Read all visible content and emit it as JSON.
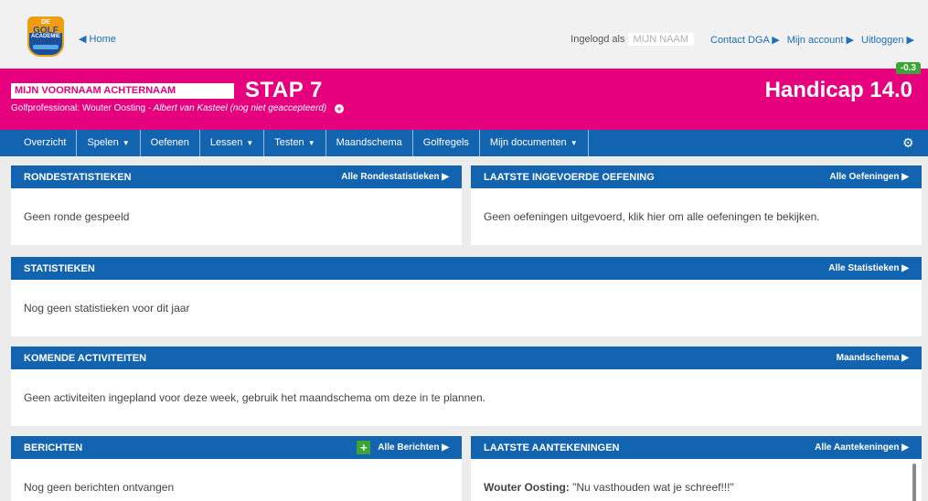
{
  "logo": {
    "line1": "DE",
    "line2": "GOLF",
    "line3": "ACADEMIE"
  },
  "header": {
    "home": "◀ Home",
    "logged_in_as": "Ingelogd als",
    "user_name": "MIJN NAAM",
    "links": [
      "Contact DGA ▶",
      "Mijn account ▶",
      "Uitloggen ▶"
    ]
  },
  "hero": {
    "full_name": "MIJN VOORNAAM ACHTERNAAM",
    "step": "STAP 7",
    "pro_label": "Golfprofessional:",
    "pro_name": "Wouter Oosting",
    "pending": "- Albert van Kasteel (nog niet geaccepteerd)",
    "handicap": "Handicap 14.0",
    "delta": "-0.3"
  },
  "nav": {
    "items": [
      {
        "label": "Overzicht",
        "caret": ""
      },
      {
        "label": "Spelen",
        "caret": "▼"
      },
      {
        "label": "Oefenen",
        "caret": ""
      },
      {
        "label": "Lessen",
        "caret": "▼"
      },
      {
        "label": "Testen",
        "caret": "▼"
      },
      {
        "label": "Maandschema",
        "caret": ""
      },
      {
        "label": "Golfregels",
        "caret": ""
      },
      {
        "label": "Mijn documenten",
        "caret": "▼"
      }
    ]
  },
  "panels": {
    "rondes": {
      "title": "RONDESTATISTIEKEN",
      "link": "Alle Rondestatistieken ▶",
      "body": "Geen ronde gespeeld"
    },
    "oefening": {
      "title": "LAATSTE INGEVOERDE OEFENING",
      "link": "Alle Oefeningen ▶",
      "body": "Geen oefeningen uitgevoerd, klik hier om alle oefeningen te bekijken."
    },
    "statistieken": {
      "title": "STATISTIEKEN",
      "link": "Alle Statistieken ▶",
      "body": "Nog geen statistieken voor dit jaar"
    },
    "activiteiten": {
      "title": "KOMENDE ACTIVITEITEN",
      "link": "Maandschema ▶",
      "body": "Geen activiteiten ingepland voor deze week, gebruik het maandschema om deze in te plannen."
    },
    "berichten": {
      "title": "BERICHTEN",
      "link": "Alle Berichten ▶",
      "body": "Nog geen berichten ontvangen"
    },
    "aantekeningen": {
      "title": "LAATSTE AANTEKENINGEN",
      "link": "Alle Aantekeningen ▶",
      "author": "Wouter Oosting:",
      "quote": "\"Nu vasthouden wat je schreef!!!\""
    }
  }
}
